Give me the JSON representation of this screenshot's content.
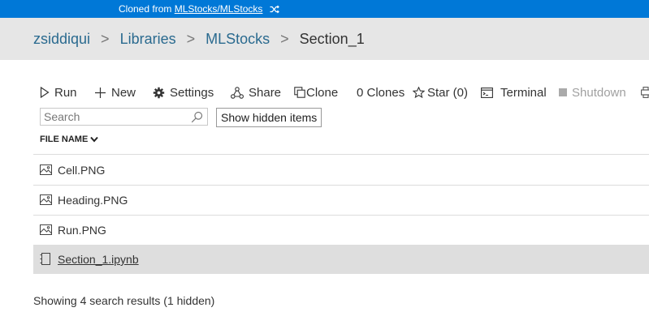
{
  "banner": {
    "prefix": "Cloned from",
    "link": "MLStocks/MLStocks"
  },
  "breadcrumb": {
    "user": "zsiddiqui",
    "library": "Libraries",
    "project": "MLStocks",
    "current": "Section_1"
  },
  "toolbar": {
    "run": "Run",
    "new": "New",
    "settings": "Settings",
    "share": "Share",
    "clone": "Clone",
    "clones": "0 Clones",
    "star": "Star (0)",
    "terminal": "Terminal",
    "shutdown": "Shutdown"
  },
  "search": {
    "placeholder": "Search",
    "value": ""
  },
  "hidden_button": "Show hidden items",
  "column": {
    "file_name": "FILE NAME"
  },
  "files": [
    {
      "name": "Cell.PNG",
      "type": "image",
      "selected": false
    },
    {
      "name": "Heading.PNG",
      "type": "image",
      "selected": false
    },
    {
      "name": "Run.PNG",
      "type": "image",
      "selected": false
    },
    {
      "name": "Section_1.ipynb",
      "type": "notebook",
      "selected": true
    }
  ],
  "status": "Showing 4 search results (1 hidden)",
  "colors": {
    "banner": "#0078d7",
    "breadcrumb_bg": "#e6e6e6",
    "link": "#2a6a8f",
    "selected_row": "#dedede"
  }
}
